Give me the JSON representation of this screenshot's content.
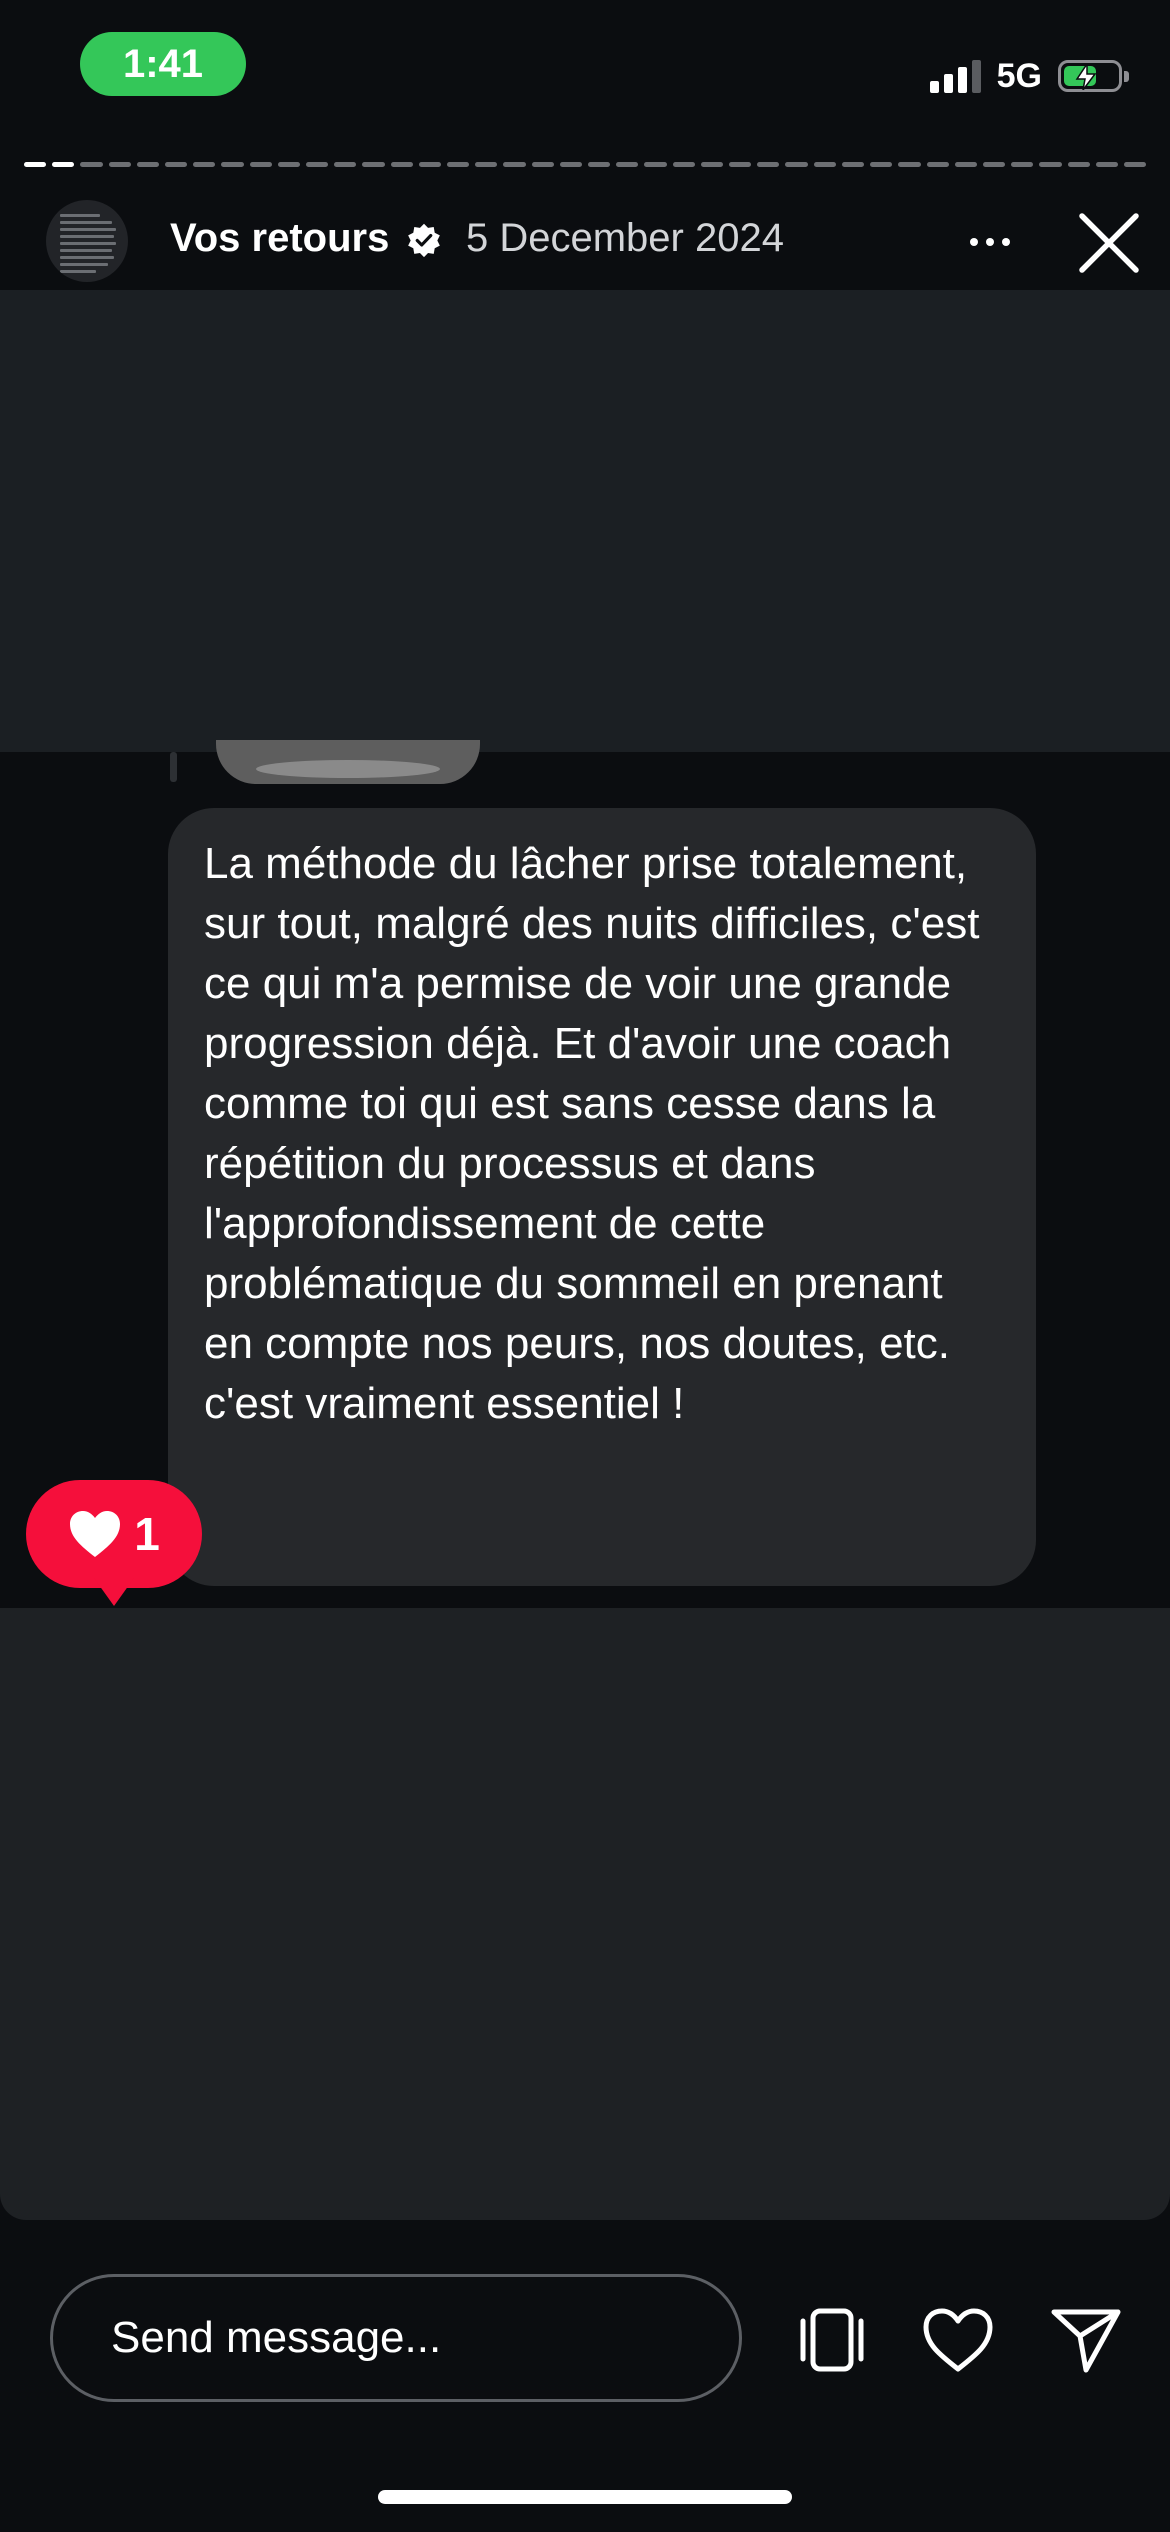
{
  "status_bar": {
    "time": "1:41",
    "network": "5G",
    "signal_bars": 3,
    "battery_charging": true
  },
  "story": {
    "progress_segments_total": 40,
    "progress_segments_viewed": 2,
    "account_name": "Vos retours",
    "verified": true,
    "date": "5 December 2024"
  },
  "message": {
    "text": "La méthode du lâcher prise totalement, sur tout, malgré des nuits difficiles, c'est ce qui m'a permise de voir une grande progression déjà. Et d'avoir une coach comme toi qui est sans cesse dans la répétition du processus et dans l'approfondissement de cette problématique du sommeil en prenant en compte nos peurs, nos doutes, etc. c'est vraiment essentiel !",
    "reaction_count": "1"
  },
  "composer": {
    "placeholder": "Send message..."
  },
  "icons": {
    "verified": "verified-badge-icon",
    "more": "more-options-icon",
    "close": "close-icon",
    "heart": "heart-icon",
    "multi_device": "multi-device-icon",
    "like": "like-icon",
    "send": "send-icon"
  },
  "colors": {
    "reaction": "#f50f3b",
    "status_time_bg": "#34c759",
    "bubble": "#26282b",
    "background": "#0b0d10"
  }
}
